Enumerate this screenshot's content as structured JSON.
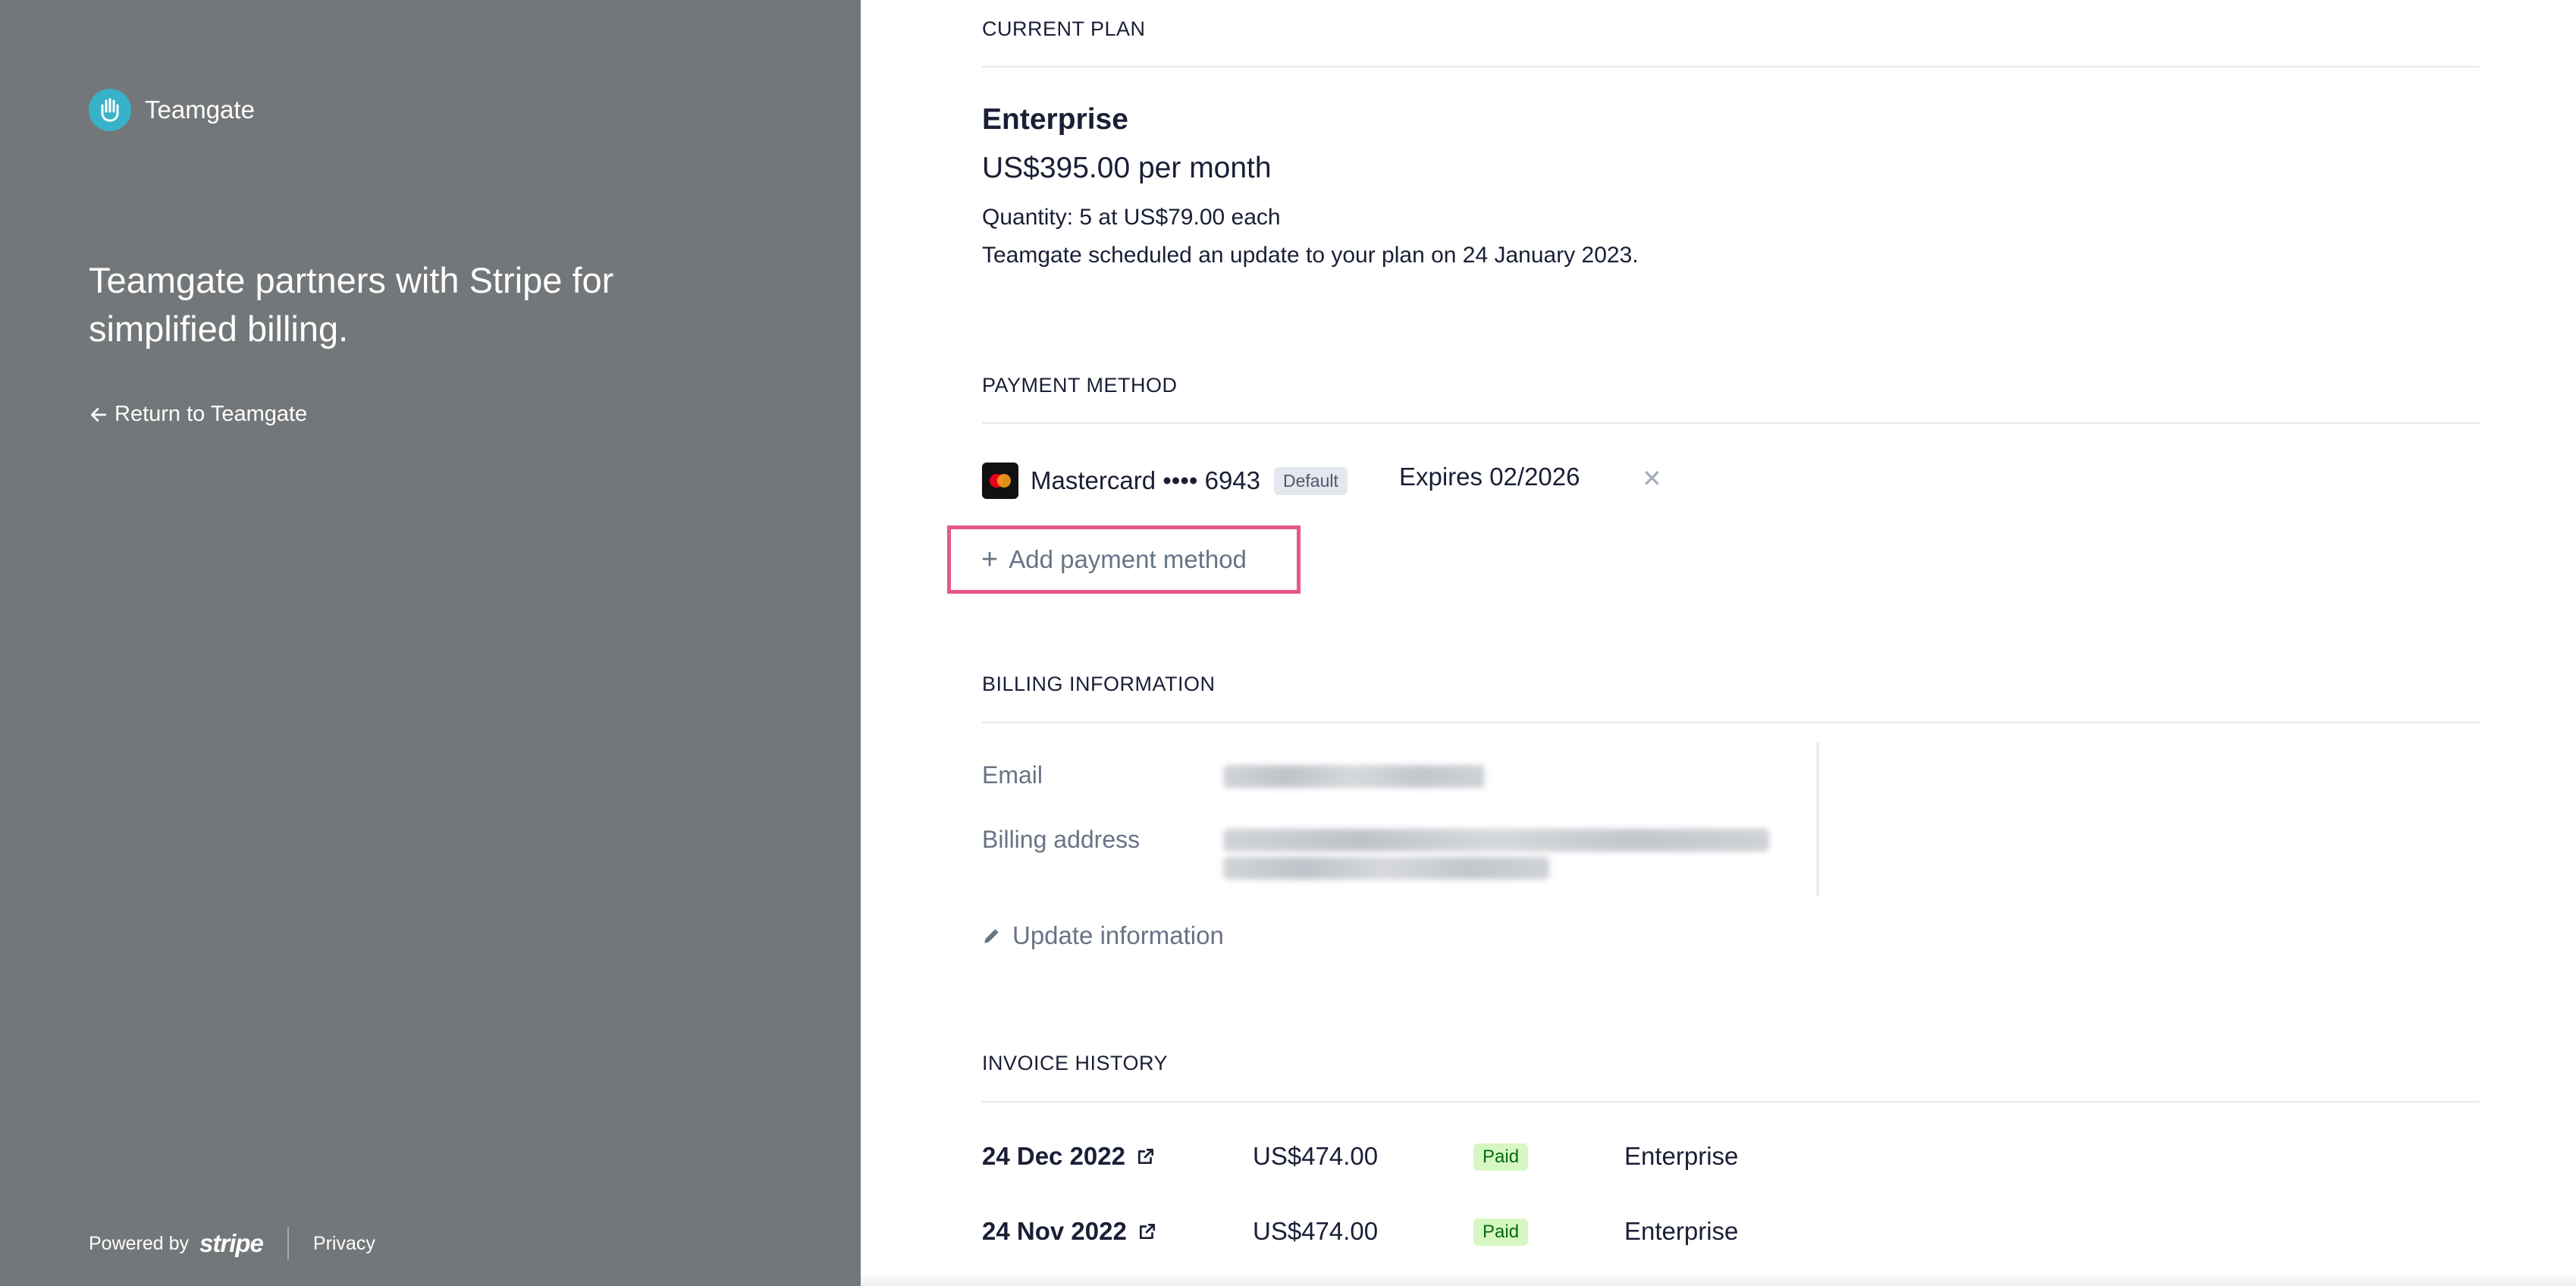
{
  "sidebar": {
    "brand_name": "Teamgate",
    "tagline": "Teamgate partners with Stripe for simplified billing.",
    "return_link": "Return to Teamgate",
    "powered_by": "Powered by",
    "stripe_word": "stripe",
    "privacy": "Privacy",
    "brand_color": "#38b2c8",
    "panel_color": "#747779"
  },
  "current_plan": {
    "section_title": "CURRENT PLAN",
    "plan_name": "Enterprise",
    "price": "US$395.00 per month",
    "quantity": "Quantity: 5 at US$79.00 each",
    "note": "Teamgate scheduled an update to your plan on 24 January 2023."
  },
  "payment_method": {
    "section_title": "PAYMENT METHOD",
    "card_label": "Mastercard •••• 6943",
    "badge": "Default",
    "expires": "Expires 02/2026",
    "add_label": "Add payment method",
    "highlight_color": "#e8578c"
  },
  "billing_info": {
    "section_title": "BILLING INFORMATION",
    "email_label": "Email",
    "address_label": "Billing address",
    "update_label": "Update information"
  },
  "invoice_history": {
    "section_title": "INVOICE HISTORY",
    "rows": [
      {
        "date": "24 Dec 2022",
        "amount": "US$474.00",
        "status": "Paid",
        "plan": "Enterprise"
      },
      {
        "date": "24 Nov 2022",
        "amount": "US$474.00",
        "status": "Paid",
        "plan": "Enterprise"
      }
    ]
  }
}
